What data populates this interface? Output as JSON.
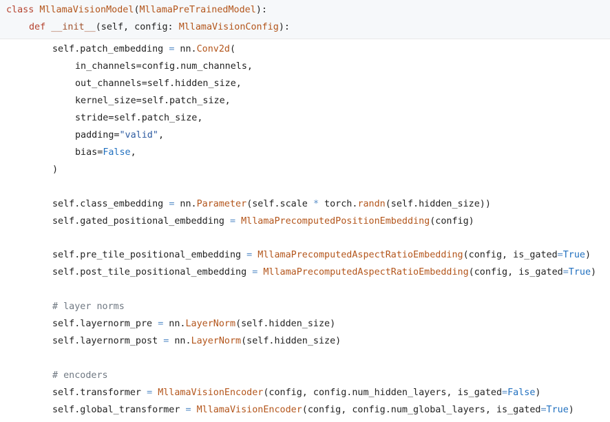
{
  "code": {
    "l1": {
      "kw": "class",
      "cls": "MllamaVisionModel",
      "p1": "(",
      "base": "MllamaPreTrainedModel",
      "p2": "):"
    },
    "l2": {
      "kw": "def",
      "fn": "__init__",
      "args": "(self, config: ",
      "type": "MllamaVisionConfig",
      "end": "):"
    },
    "l3": {
      "a": "self.patch_embedding ",
      "op": "=",
      "b": " nn.",
      "call": "Conv2d",
      "c": "("
    },
    "l4": "in_channels=config.num_channels,",
    "l5": "out_channels=self.hidden_size,",
    "l6": "kernel_size=self.patch_size,",
    "l7": "stride=self.patch_size,",
    "l8": {
      "a": "padding=",
      "str": "\"valid\"",
      "b": ","
    },
    "l9": {
      "a": "bias=",
      "lit": "False",
      "b": ","
    },
    "l10": ")",
    "l11": {
      "a": "self.class_embedding ",
      "op": "=",
      "b": " nn.",
      "call": "Parameter",
      "c": "(self.scale ",
      "op2": "*",
      "d": " torch.",
      "call2": "randn",
      "e": "(self.hidden_size))"
    },
    "l12": {
      "a": "self.gated_positional_embedding ",
      "op": "=",
      "b": " ",
      "call": "MllamaPrecomputedPositionEmbedding",
      "c": "(config)"
    },
    "l13": {
      "a": "self.pre_tile_positional_embedding ",
      "op": "=",
      "b": " ",
      "call": "MllamaPrecomputedAspectRatioEmbedding",
      "c": "(config, is_gated",
      "op2": "=",
      "lit": "True",
      "d": ")"
    },
    "l14": {
      "a": "self.post_tile_positional_embedding ",
      "op": "=",
      "b": " ",
      "call": "MllamaPrecomputedAspectRatioEmbedding",
      "c": "(config, is_gated",
      "op2": "=",
      "lit": "True",
      "d": ")"
    },
    "l15": "# layer norms",
    "l16": {
      "a": "self.layernorm_pre ",
      "op": "=",
      "b": " nn.",
      "call": "LayerNorm",
      "c": "(self.hidden_size)"
    },
    "l17": {
      "a": "self.layernorm_post ",
      "op": "=",
      "b": " nn.",
      "call": "LayerNorm",
      "c": "(self.hidden_size)"
    },
    "l18": "# encoders",
    "l19": {
      "a": "self.transformer ",
      "op": "=",
      "b": " ",
      "call": "MllamaVisionEncoder",
      "c": "(config, config.num_hidden_layers, is_gated",
      "op2": "=",
      "lit": "False",
      "d": ")"
    },
    "l20": {
      "a": "self.global_transformer ",
      "op": "=",
      "b": " ",
      "call": "MllamaVisionEncoder",
      "c": "(config, config.num_global_layers, is_gated",
      "op2": "=",
      "lit": "True",
      "d": ")"
    }
  }
}
